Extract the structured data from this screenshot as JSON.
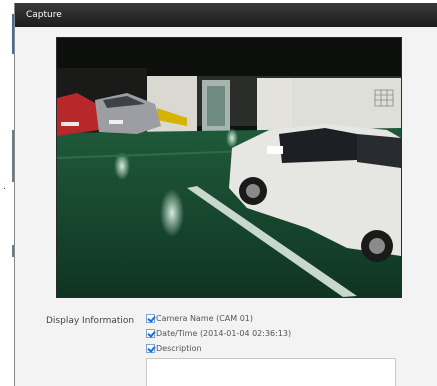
{
  "window": {
    "title": "Capture"
  },
  "display_information": {
    "label": "Display Information",
    "options": [
      {
        "label": "Camera Name (CAM 01)",
        "checked": true
      },
      {
        "label": "Date/Time (2014-01-04 02:36:13)",
        "checked": true
      },
      {
        "label": "Description",
        "checked": true
      }
    ],
    "description_value": ""
  },
  "colors": {
    "titlebar": "#1c1c1c",
    "checkbox_accent": "#1a6fd0"
  }
}
